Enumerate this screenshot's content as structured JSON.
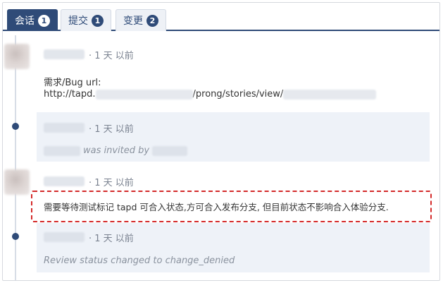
{
  "tabs": [
    {
      "label": "会话",
      "count": "1",
      "active": true
    },
    {
      "label": "提交",
      "count": "1",
      "active": false
    },
    {
      "label": "变更",
      "count": "2",
      "active": false
    }
  ],
  "entries": [
    {
      "time": "· 1 天 以前",
      "line1": "需求/Bug url:",
      "url_prefix": "http://tapd.",
      "url_path": "/prong/stories/view/"
    },
    {
      "time": "· 1 天 以前",
      "text": "was invited by"
    },
    {
      "time": "· 1 天 以前",
      "text": "需要等待测试标记 tapd 可合入状态,方可合入发布分支, 但目前状态不影响合入体验分支."
    },
    {
      "time": "· 1 天 以前",
      "text": "Review status changed to change_denied"
    }
  ],
  "colors": {
    "accent": "#2f4b78",
    "highlight_border": "#d42a2a",
    "shaded_bg": "#eef2f8"
  }
}
